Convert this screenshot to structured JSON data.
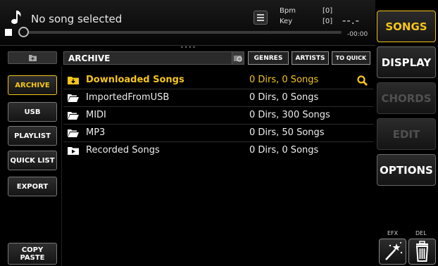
{
  "player": {
    "song_title": "No song selected",
    "bpm_label": "Bpm",
    "bpm_value": "[0]",
    "key_label": "Key",
    "key_value": "[0]",
    "time_main": "--.-",
    "time_sub": "-00:00",
    "icons": [
      "music-note-icon",
      "stop-icon",
      "list-icon"
    ]
  },
  "browser": {
    "folder_header": "ARCHIVE",
    "genres_label": "GENRES",
    "artists_label": "ARTISTS",
    "to_quick_label": "TO QUICK",
    "rows": [
      {
        "name": "Downloaded Songs",
        "info": "0 Dirs, 0 Songs",
        "selected": true
      },
      {
        "name": "ImportedFromUSB",
        "info": "0 Dirs, 0 Songs",
        "selected": false
      },
      {
        "name": "MIDI",
        "info": "0 Dirs, 300 Songs",
        "selected": false
      },
      {
        "name": "MP3",
        "info": "0 Dirs, 50 Songs",
        "selected": false
      },
      {
        "name": "Recorded Songs",
        "info": "0 Dirs, 0 Songs",
        "selected": false
      }
    ]
  },
  "left_menu": {
    "archive": "ARCHIVE",
    "usb": "USB",
    "playlist": "PLAYLIST",
    "quick_list": "QUICK LIST",
    "export": "EXPORT",
    "copy_paste": "COPY PASTE"
  },
  "right_menu": {
    "songs": "SONGS",
    "display": "DISPLAY",
    "chords": "CHORDS",
    "edit": "EDIT",
    "options": "OPTIONS",
    "efx_label": "EFX",
    "del_label": "DEL"
  },
  "colors": {
    "accent": "#f5c518",
    "background": "#000000",
    "disabled": "#505050"
  }
}
